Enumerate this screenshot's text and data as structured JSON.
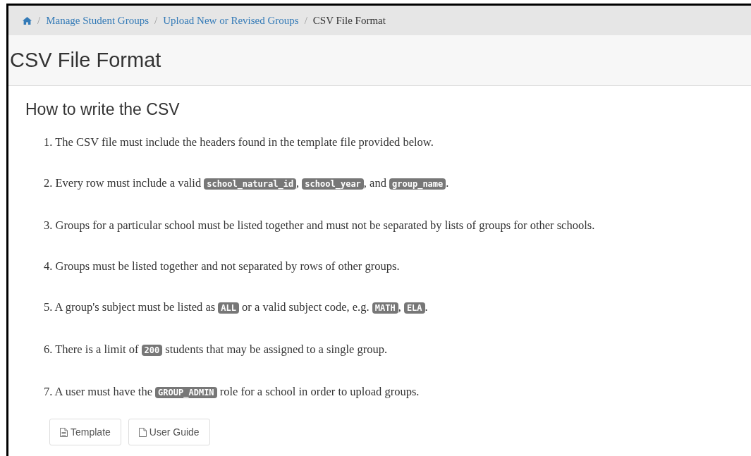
{
  "breadcrumb_separator": "/",
  "breadcrumb": [
    {
      "kind": "home"
    },
    {
      "kind": "link",
      "label": "Manage Student Groups"
    },
    {
      "kind": "link",
      "label": "Upload New or Revised Groups"
    },
    {
      "kind": "current",
      "label": "CSV File Format"
    }
  ],
  "page_title": "CSV File Format",
  "section_title": "How to write the CSV",
  "steps": [
    {
      "number": "1.",
      "parts": [
        {
          "kind": "text",
          "text": "The CSV file must include the headers found in the template file provided below."
        }
      ]
    },
    {
      "number": "2.",
      "parts": [
        {
          "kind": "text",
          "text": "Every row must include a valid "
        },
        {
          "kind": "code",
          "text": "school_natural_id"
        },
        {
          "kind": "text",
          "text": ", "
        },
        {
          "kind": "code",
          "text": "school_year"
        },
        {
          "kind": "text",
          "text": ", and "
        },
        {
          "kind": "code",
          "text": "group_name"
        },
        {
          "kind": "text",
          "text": "."
        }
      ]
    },
    {
      "number": "3.",
      "parts": [
        {
          "kind": "text",
          "text": "Groups for a particular school must be listed together and must not be separated by lists of groups for other schools."
        }
      ]
    },
    {
      "number": "4.",
      "parts": [
        {
          "kind": "text",
          "text": "Groups must be listed together and not separated by rows of other groups."
        }
      ]
    },
    {
      "number": "5.",
      "parts": [
        {
          "kind": "text",
          "text": "A group's subject must be listed as "
        },
        {
          "kind": "code",
          "text": "ALL"
        },
        {
          "kind": "text",
          "text": " or a valid subject code, e.g. "
        },
        {
          "kind": "code",
          "text": "MATH"
        },
        {
          "kind": "text",
          "text": ", "
        },
        {
          "kind": "code",
          "text": "ELA"
        },
        {
          "kind": "text",
          "text": "."
        }
      ]
    },
    {
      "number": "6.",
      "parts": [
        {
          "kind": "text",
          "text": "There is a limit of "
        },
        {
          "kind": "code",
          "text": "200"
        },
        {
          "kind": "text",
          "text": " students that may be assigned to a single group."
        }
      ]
    },
    {
      "number": "7.",
      "parts": [
        {
          "kind": "text",
          "text": "A user must have the "
        },
        {
          "kind": "code",
          "text": "GROUP_ADMIN"
        },
        {
          "kind": "text",
          "text": " role for a school in order to upload groups."
        }
      ]
    }
  ],
  "buttons": [
    {
      "kind": "template",
      "label": "Template"
    },
    {
      "kind": "guide",
      "label": "User Guide"
    }
  ]
}
